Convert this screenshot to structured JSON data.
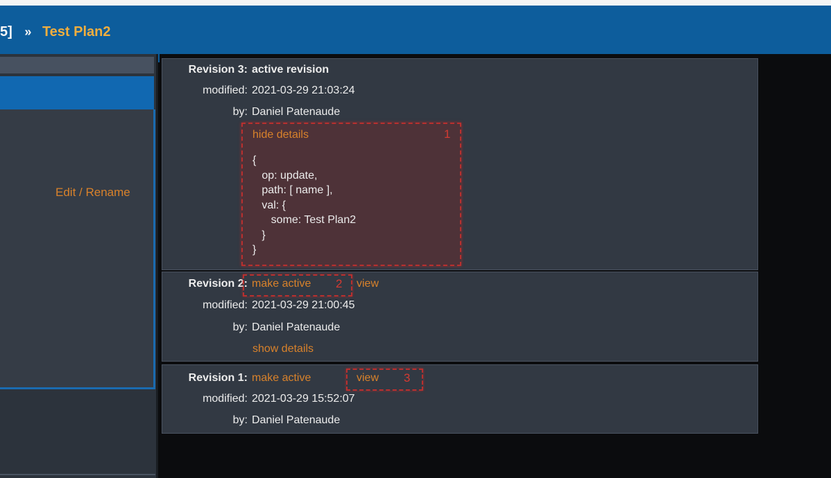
{
  "header": {
    "breadcrumb_prev": "5]",
    "breadcrumb_sep": "»",
    "breadcrumb_current": "Test Plan2"
  },
  "sidebar": {
    "edit_link": "Edit / Rename"
  },
  "revisions": [
    {
      "label": "Revision 3:",
      "status": "active revision",
      "modified_label": "modified:",
      "modified": "2021-03-29 21:03:24",
      "by_label": "by:",
      "by": "Daniel Patenaude",
      "details_link": "hide details",
      "details_lines": [
        "{",
        "   op: update,",
        "   path: [ name ],",
        "   val: {",
        "      some: Test Plan2",
        "   }",
        "}"
      ]
    },
    {
      "label": "Revision 2:",
      "make_active": "make active",
      "view": "view",
      "modified_label": "modified:",
      "modified": "2021-03-29 21:00:45",
      "by_label": "by:",
      "by": "Daniel Patenaude",
      "details_link": "show details"
    },
    {
      "label": "Revision 1:",
      "make_active": "make active",
      "view": "view",
      "modified_label": "modified:",
      "modified": "2021-03-29 15:52:07",
      "by_label": "by:",
      "by": "Daniel Patenaude"
    }
  ],
  "annotations": {
    "mark1": "1",
    "mark2": "2",
    "mark3": "3"
  },
  "colors": {
    "header_bg": "#0d5d9c",
    "link": "#d9822b",
    "breadcrumb_current": "#f0ae3e",
    "annotation": "#b8302f"
  }
}
